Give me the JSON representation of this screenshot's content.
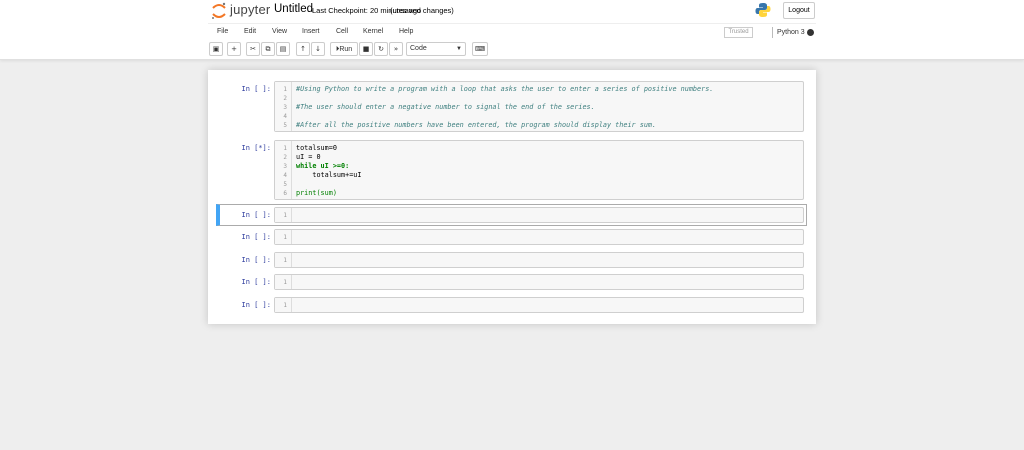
{
  "header": {
    "logo_text": "jupyter",
    "notebook_name": "Untitled",
    "checkpoint": "Last Checkpoint: 20 minutes ago",
    "unsaved": "(unsaved changes)",
    "logout_label": "Logout"
  },
  "menubar": {
    "items": [
      "File",
      "Edit",
      "View",
      "Insert",
      "Cell",
      "Kernel",
      "Help"
    ],
    "trusted": "Trusted",
    "kernel": "Python 3"
  },
  "toolbar": {
    "run_label": "Run",
    "cell_type": "Code"
  },
  "cells": [
    {
      "prompt": "In [ ]:",
      "line_numbers": [
        "1",
        "2",
        "3",
        "4",
        "5"
      ],
      "lines": [
        "#Using Python to write a program with a loop that asks the user to enter a series of positive numbers.",
        "",
        "#The user should enter a negative number to signal the end of the series.",
        "",
        "#After all the positive numbers have been entered, the program should display their sum."
      ]
    },
    {
      "prompt": "In [*]:",
      "line_numbers": [
        "1",
        "2",
        "3",
        "4",
        "5",
        "6"
      ],
      "lines": [
        "totalsum=0",
        "uI = 0",
        "while uI >=0:",
        "    totalsum+=uI",
        "",
        "print(sum)"
      ]
    },
    {
      "prompt": "In [ ]:",
      "line_numbers": [
        "1"
      ]
    },
    {
      "prompt": "In [ ]:",
      "line_numbers": [
        "1"
      ]
    },
    {
      "prompt": "In [ ]:",
      "line_numbers": [
        "1"
      ]
    },
    {
      "prompt": "In [ ]:",
      "line_numbers": [
        "1"
      ]
    },
    {
      "prompt": "In [ ]:",
      "line_numbers": [
        "1"
      ]
    }
  ],
  "colors": {
    "accent": "#42a5f5",
    "prompt": "#303f9f",
    "comment": "#408080",
    "keyword": "#008000"
  },
  "icons": [
    "save-icon",
    "add-cell-icon",
    "cut-icon",
    "copy-icon",
    "paste-icon",
    "move-up-icon",
    "move-down-icon",
    "run-icon",
    "stop-icon",
    "restart-icon",
    "fast-forward-icon",
    "keyboard-icon"
  ]
}
